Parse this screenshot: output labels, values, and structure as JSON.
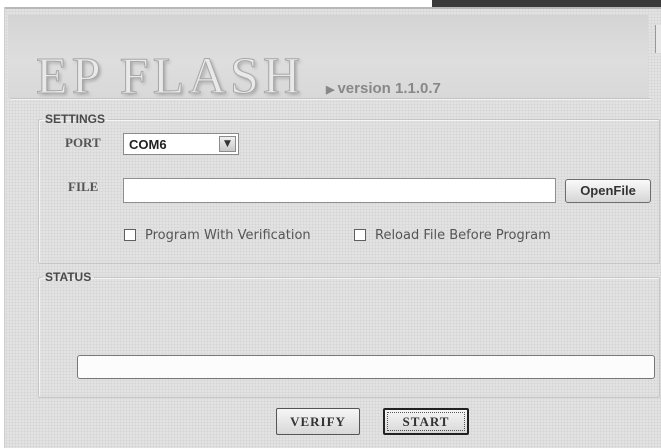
{
  "app": {
    "logo_text": "EP FLASH",
    "version_text": "version 1.1.0.7"
  },
  "settings": {
    "legend": "SETTINGS",
    "port_label": "PORT",
    "port_value": "COM6",
    "file_label": "FILE",
    "file_value": "",
    "open_button": "OpenFile",
    "option_verify": {
      "label": "Program With Verification",
      "checked": false
    },
    "option_reload": {
      "label": "Reload File Before Program",
      "checked": false
    }
  },
  "status": {
    "legend": "STATUS",
    "progress": 0
  },
  "actions": {
    "verify_label": "VERIFY",
    "start_label": "START"
  },
  "icons": {
    "dropdown": "chevron-down-icon",
    "version_marker": "triangle-right-icon"
  }
}
